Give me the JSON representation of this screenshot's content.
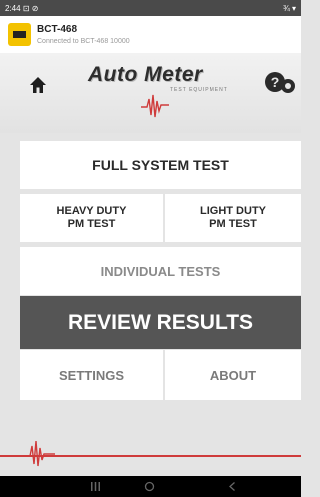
{
  "status_bar": {
    "time": "2:44",
    "left_icons": "⊡ ⊘",
    "right_icons": "¾ ▾"
  },
  "device": {
    "name": "BCT-468",
    "subtitle": "Connected to BCT-468 10000"
  },
  "header": {
    "icons": [
      "home-icon",
      "help-icon"
    ],
    "logo_text": "Auto Meter",
    "logo_sub": "TEST EQUIPMENT"
  },
  "menu": {
    "full_system_test": "FULL SYSTEM TEST",
    "heavy_duty": {
      "line1": "HEAVY DUTY",
      "line2": "PM TEST"
    },
    "light_duty": {
      "line1": "LIGHT DUTY",
      "line2": "PM TEST"
    },
    "individual_tests": "INDIVIDUAL TESTS",
    "review_results": "REVIEW RESULTS",
    "settings": "SETTINGS",
    "about": "ABOUT"
  },
  "colors": {
    "accent_red": "#cf3b3b",
    "review_bg": "#555555",
    "device_icon": "#f3c200"
  },
  "nav_bar": {
    "icons": [
      "recents-icon",
      "home-nav-icon",
      "back-icon"
    ]
  }
}
